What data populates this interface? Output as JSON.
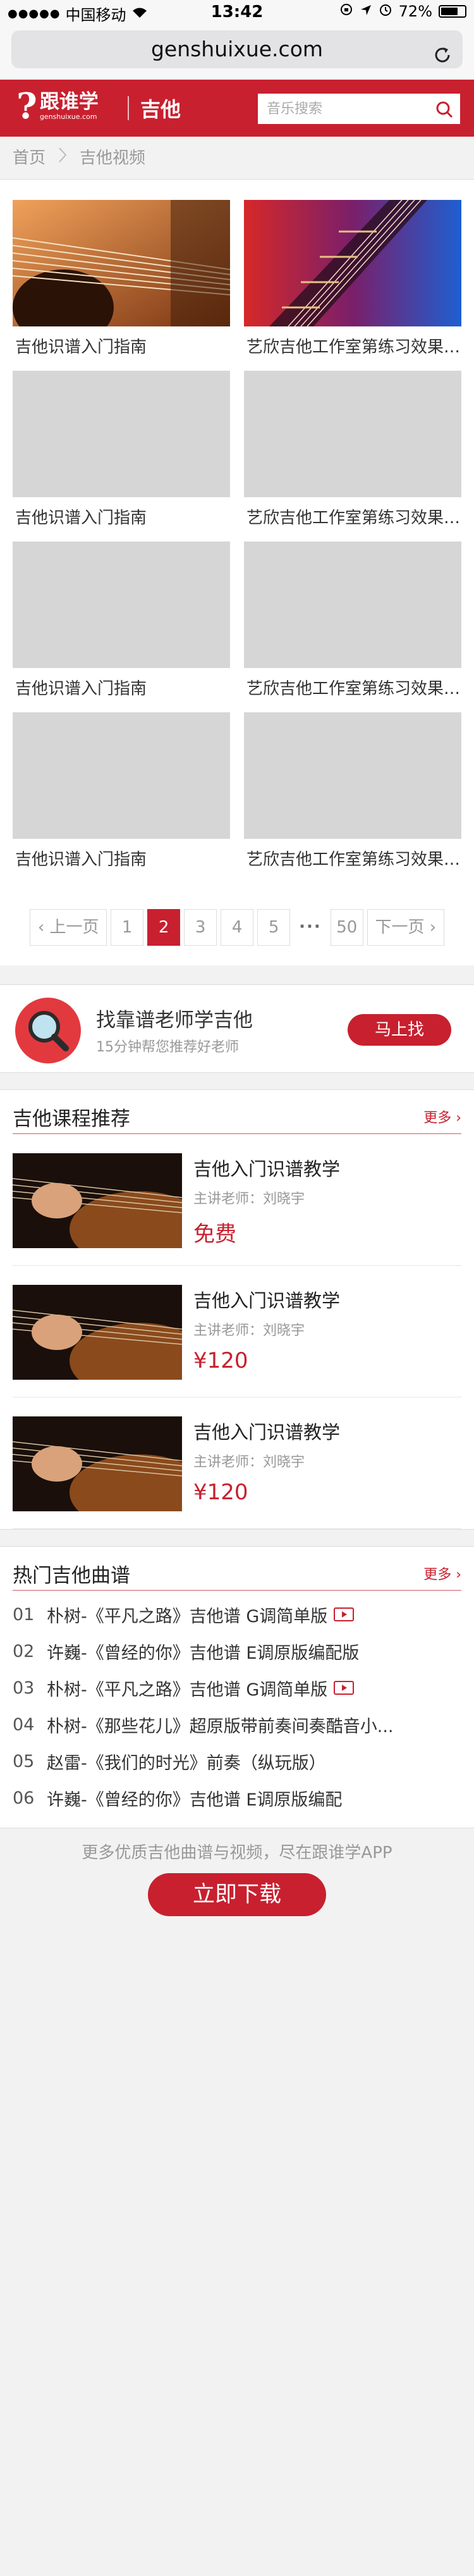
{
  "status_bar": {
    "carrier": "中国移动",
    "time": "13:42",
    "battery": "72%",
    "battery_level": 0.72
  },
  "browser": {
    "url": "genshuixue.com"
  },
  "header": {
    "logo_mark": "?",
    "logo_name": "跟谁学",
    "logo_domain": "genshuixue.com",
    "category": "吉他",
    "search_placeholder": "音乐搜索"
  },
  "breadcrumb": {
    "home": "首页",
    "current": "吉他视频"
  },
  "videos": [
    {
      "title": "吉他识谱入门指南",
      "thumb": "guitar-closeup-warm"
    },
    {
      "title": "艺欣吉他工作室第练习效果展示",
      "thumb": "guitar-neck-blue-red"
    },
    {
      "title": "吉他识谱入门指南",
      "thumb": "placeholder"
    },
    {
      "title": "艺欣吉他工作室第练习效果展示",
      "thumb": "placeholder"
    },
    {
      "title": "吉他识谱入门指南",
      "thumb": "placeholder"
    },
    {
      "title": "艺欣吉他工作室第练习效果展示",
      "thumb": "placeholder"
    },
    {
      "title": "吉他识谱入门指南",
      "thumb": "placeholder"
    },
    {
      "title": "艺欣吉他工作室第练习效果展示",
      "thumb": "placeholder"
    }
  ],
  "pagination": {
    "prev": "上一页",
    "pages": [
      "1",
      "2",
      "3",
      "4",
      "5"
    ],
    "current": "2",
    "ellipsis": "···",
    "last": "50",
    "next": "下一页"
  },
  "find_teacher": {
    "title": "找靠谱老师学吉他",
    "subtitle": "15分钟帮您推荐好老师",
    "button": "马上找"
  },
  "courses": {
    "heading": "吉他课程推荐",
    "more": "更多",
    "items": [
      {
        "title": "吉他入门识谱教学",
        "teacher": "主讲老师：刘晓宇",
        "price": "免费"
      },
      {
        "title": "吉他入门识谱教学",
        "teacher": "主讲老师：刘晓宇",
        "price": "¥120"
      },
      {
        "title": "吉他入门识谱教学",
        "teacher": "主讲老师：刘晓宇",
        "price": "¥120"
      }
    ]
  },
  "hot_songs": {
    "heading": "热门吉他曲谱",
    "more": "更多",
    "items": [
      {
        "num": "01",
        "title": "朴树-《平凡之路》吉他谱 G调简单版",
        "video": true
      },
      {
        "num": "02",
        "title": "许巍-《曾经的你》吉他谱 E调原版编配版",
        "video": false
      },
      {
        "num": "03",
        "title": "朴树-《平凡之路》吉他谱 G调简单版",
        "video": true
      },
      {
        "num": "04",
        "title": "朴树-《那些花儿》超原版带前奏间奏酷音小...",
        "video": false
      },
      {
        "num": "05",
        "title": "赵雷-《我们的时光》前奏（纵玩版）",
        "video": false
      },
      {
        "num": "06",
        "title": "许巍-《曾经的你》吉他谱 E调原版编配",
        "video": false
      }
    ]
  },
  "footer": {
    "text": "更多优质吉他曲谱与视频，尽在跟谁学APP",
    "download": "立即下载"
  },
  "colors": {
    "brand_red": "#c8202f"
  }
}
